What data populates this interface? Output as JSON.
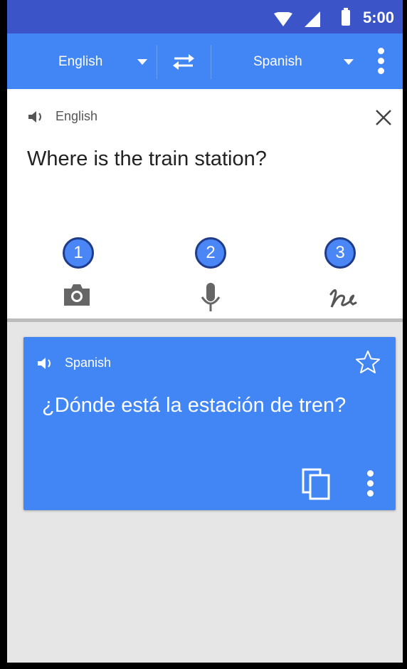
{
  "status_bar": {
    "time": "5:00"
  },
  "toolbar": {
    "source_language": "English",
    "target_language": "Spanish"
  },
  "input": {
    "language_label": "English",
    "text": "Where is the train station?",
    "tools": [
      {
        "badge": "1",
        "icon": "camera-icon"
      },
      {
        "badge": "2",
        "icon": "mic-icon"
      },
      {
        "badge": "3",
        "icon": "handwriting-icon"
      }
    ]
  },
  "result": {
    "language_label": "Spanish",
    "text": "¿Dónde está la estación de tren?"
  },
  "colors": {
    "status_bar": "#3b54c8",
    "accent": "#4285f4",
    "badge": "#4a86f5",
    "badge_border": "#1e3c8a",
    "background": "#e6e6e6"
  }
}
